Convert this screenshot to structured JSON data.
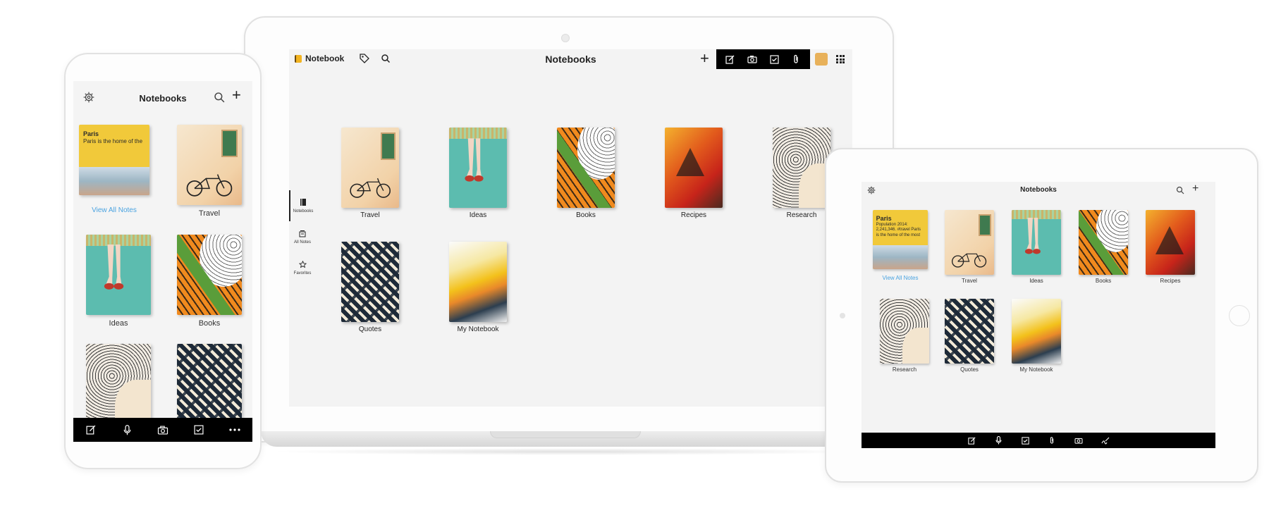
{
  "laptop": {
    "app_name": "Notebook",
    "title": "Notebooks",
    "toolbar_icons": [
      "tag-icon",
      "search-icon",
      "plus-icon",
      "note-icon",
      "camera-icon",
      "checklist-icon",
      "attachment-icon",
      "avatar",
      "apps-grid-icon"
    ],
    "sidebar": [
      {
        "label": "Notebooks",
        "icon": "notebook-icon",
        "active": true
      },
      {
        "label": "All Notes",
        "icon": "all-notes-icon",
        "active": false
      },
      {
        "label": "Favorites",
        "icon": "star-icon",
        "active": false
      }
    ],
    "notebooks": [
      {
        "label": "Travel",
        "art": "travel"
      },
      {
        "label": "Ideas",
        "art": "ideas"
      },
      {
        "label": "Books",
        "art": "books"
      },
      {
        "label": "Recipes",
        "art": "recipes"
      },
      {
        "label": "Research",
        "art": "research"
      },
      {
        "label": "Quotes",
        "art": "quotes"
      },
      {
        "label": "My Notebook",
        "art": "mynb"
      }
    ]
  },
  "phone": {
    "title": "Notebooks",
    "paris_note": {
      "title": "Paris",
      "body": "Paris is the home of the"
    },
    "view_all": "View All Notes",
    "notebooks": [
      {
        "label": "Travel",
        "art": "travel"
      },
      {
        "label": "Ideas",
        "art": "ideas"
      },
      {
        "label": "Books",
        "art": "books"
      },
      {
        "label": "",
        "art": "research"
      },
      {
        "label": "",
        "art": "quotes"
      }
    ],
    "bottom_icons": [
      "note-icon",
      "microphone-icon",
      "camera-icon",
      "checklist-icon",
      "more-icon"
    ]
  },
  "tablet": {
    "title": "Notebooks",
    "paris_note": {
      "title": "Paris",
      "body": "Population 2014: 2,241,346. #travel Paris is the home of the most"
    },
    "view_all": "View All Notes",
    "notebooks": [
      {
        "label": "Travel",
        "art": "travel"
      },
      {
        "label": "Ideas",
        "art": "ideas"
      },
      {
        "label": "Books",
        "art": "books"
      },
      {
        "label": "Recipes",
        "art": "recipes"
      },
      {
        "label": "Research",
        "art": "research"
      },
      {
        "label": "Quotes",
        "art": "quotes"
      },
      {
        "label": "My Notebook",
        "art": "mynb"
      }
    ],
    "bottom_icons": [
      "note-icon",
      "microphone-icon",
      "checklist-icon",
      "attachment-icon",
      "camera-icon",
      "handwriting-icon"
    ]
  }
}
